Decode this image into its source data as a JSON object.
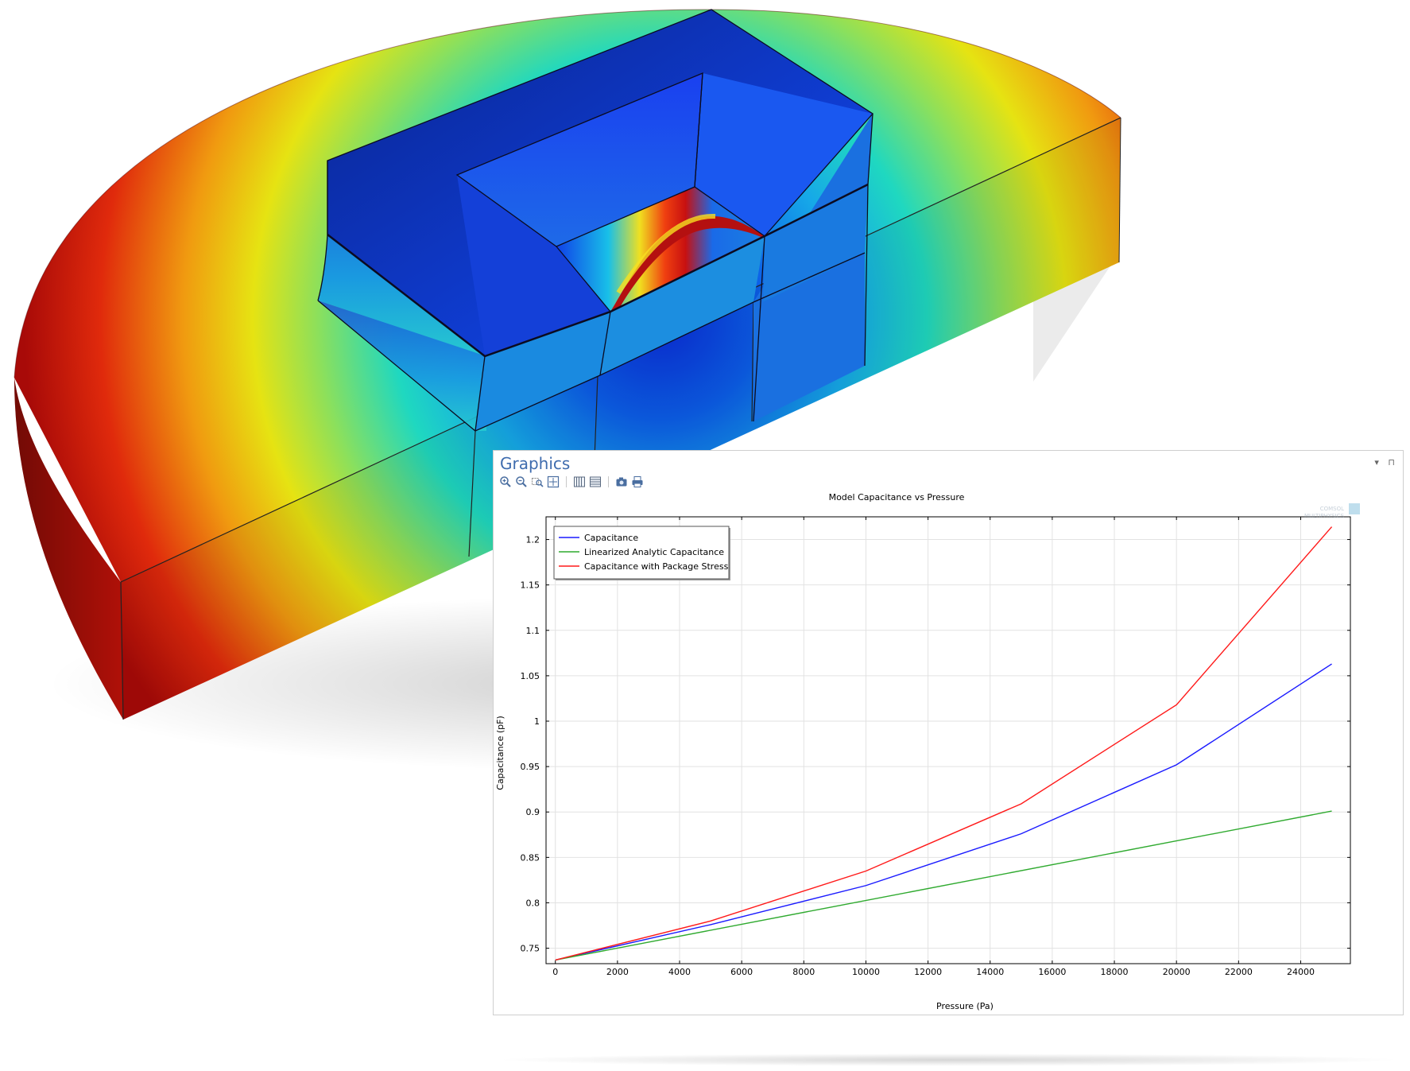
{
  "panel": {
    "title": "Graphics",
    "controls": "▾ ⊓",
    "watermark_line1": "COMSOL",
    "watermark_line2": "MULTIPHYSICS"
  },
  "toolbar": {
    "buttons": [
      "zoom-in-icon",
      "zoom-out-icon",
      "zoom-box-icon",
      "zoom-extents-icon",
      "scene-light-icon",
      "grid-toggle-icon",
      "camera-icon",
      "print-icon"
    ]
  },
  "colors": {
    "capacitance": "#1a1aff",
    "linearized": "#2faa2f",
    "package_stress": "#ff1a1a",
    "title_blue": "#3f6cae"
  },
  "chart_data": {
    "type": "line",
    "title": "Model Capacitance vs Pressure",
    "xlabel": "Pressure (Pa)",
    "ylabel": "Capacitance (pF)",
    "xlim": [
      -300,
      25600
    ],
    "ylim": [
      0.733,
      1.225
    ],
    "xticks": [
      0,
      2000,
      4000,
      6000,
      8000,
      10000,
      12000,
      14000,
      16000,
      18000,
      20000,
      22000,
      24000
    ],
    "xtick_labels": [
      "0",
      "2000",
      "4000",
      "6000",
      "8000",
      "10000",
      "12000",
      "14000",
      "16000",
      "18000",
      "20000",
      "22000",
      "24000"
    ],
    "yticks": [
      0.75,
      0.8,
      0.85,
      0.9,
      0.95,
      1.0,
      1.05,
      1.1,
      1.15,
      1.2
    ],
    "ytick_labels": [
      "0.75",
      "0.8",
      "0.85",
      "0.9",
      "0.95",
      "1",
      "1.05",
      "1.1",
      "1.15",
      "1.2"
    ],
    "grid": true,
    "legend_position": "top-left",
    "series": [
      {
        "name": "Capacitance",
        "color": "#1a1aff",
        "x": [
          0,
          5000,
          10000,
          15000,
          20000,
          25000
        ],
        "y": [
          0.737,
          0.776,
          0.819,
          0.876,
          0.952,
          1.063
        ]
      },
      {
        "name": "Linearized Analytic Capacitance",
        "color": "#2faa2f",
        "x": [
          0,
          25000
        ],
        "y": [
          0.737,
          0.901
        ]
      },
      {
        "name": "Capacitance with Package Stress",
        "color": "#ff1a1a",
        "x": [
          0,
          5000,
          10000,
          15000,
          20000,
          25000
        ],
        "y": [
          0.737,
          0.78,
          0.835,
          0.909,
          1.018,
          1.214
        ]
      }
    ]
  }
}
